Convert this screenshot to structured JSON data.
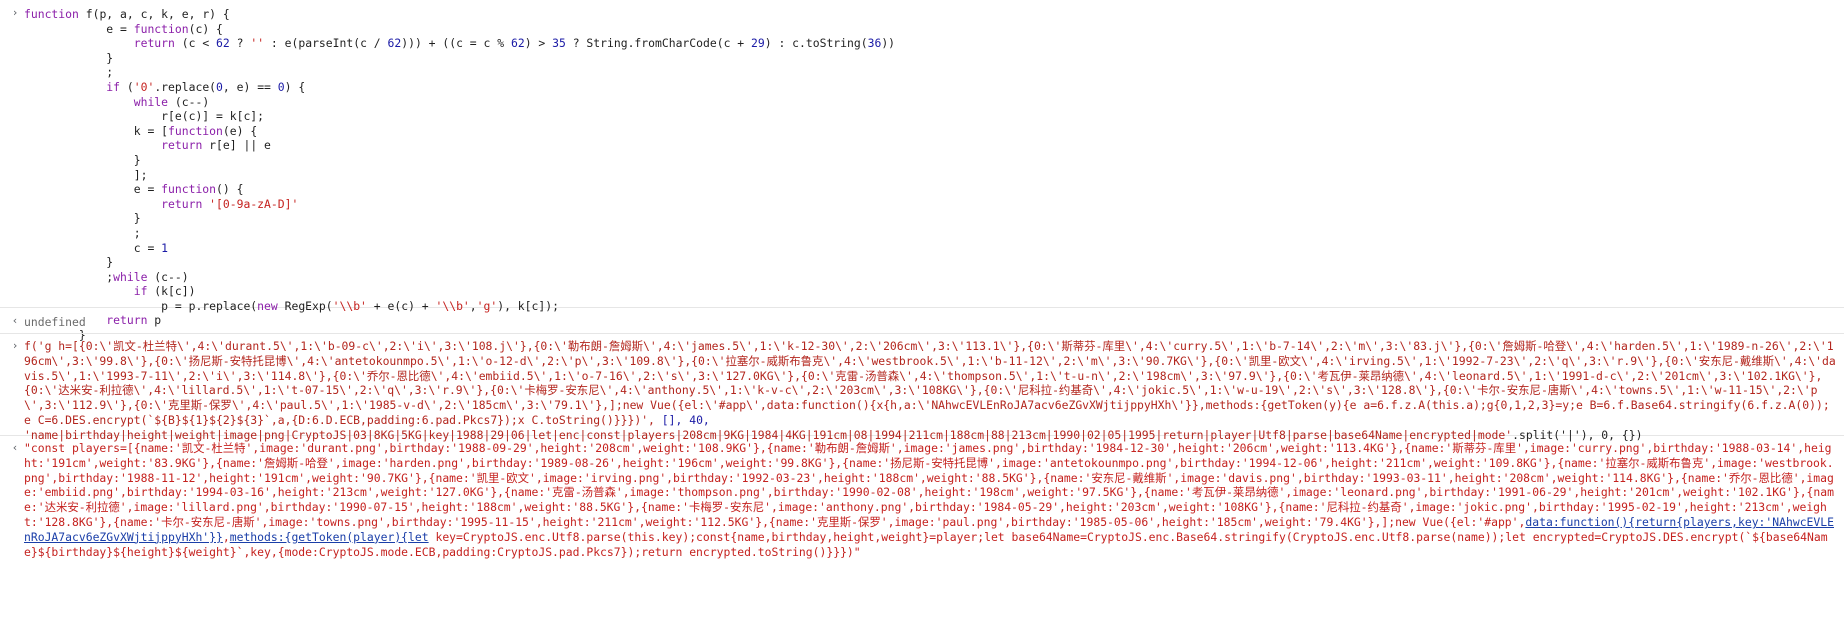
{
  "console": {
    "entry1": {
      "prompt_icon": "chevron-right-icon",
      "lines": [
        "function f(p, a, c, k, e, r) {",
        "            e = function(c) {",
        "                return (c < 62 ? '' : e(parseInt(c / 62))) + ((c = c % 62) > 35 ? String.fromCharCode(c + 29) : c.toString(36))",
        "            }",
        "            ;",
        "            if ('0'.replace(0, e) == 0) {",
        "                while (c--)",
        "                    r[e(c)] = k[c];",
        "                k = [function(e) {",
        "                    return r[e] || e",
        "                }",
        "                ];",
        "                e = function() {",
        "                    return '[0-9a-zA-D]'",
        "                }",
        "                ;",
        "                c = 1",
        "            }",
        "            ;while (c--)",
        "                if (k[c])",
        "                    p = p.replace(new RegExp('\\\\b' + e(c) + '\\\\b','g'), k[c]);",
        "            return p",
        "        }"
      ]
    },
    "entry2": {
      "result_icon": "chevron-left-icon",
      "value": "undefined"
    },
    "entry3": {
      "prompt_icon": "chevron-right-icon",
      "code": "f('g h=[{0:\\'凯文-杜兰特\\',4:\\'durant.5\\',1:\\'b-09-c\\',2:\\'i\\',3:\\'108.j\\'},{0:\\'勒布朗-詹姆斯\\',4:\\'james.5\\',1:\\'k-12-30\\',2:\\'206cm\\',3:\\'113.1\\'},{0:\\'斯蒂芬-库里\\',4:\\'curry.5\\',1:\\'b-7-14\\',2:\\'m\\',3:\\'83.j\\'},{0:\\'詹姆斯-哈登\\',4:\\'harden.5\\',1:\\'1989-n-26\\',2:\\'196cm\\',3:\\'99.8\\'},{0:\\'扬尼斯-安特托昆博\\',4:\\'antetokounmpo.5\\',1:\\'o-12-d\\',2:\\'p\\',3:\\'109.8\\'},{0:\\'拉塞尔-威斯布鲁克\\',4:\\'westbrook.5\\',1:\\'b-11-12\\',2:\\'m\\',3:\\'90.7KG\\'},{0:\\'凯里-欧文\\',4:\\'irving.5\\',1:\\'1992-7-23\\',2:\\'q\\',3:\\'r.9\\'},{0:\\'安东尼-戴维斯\\',4:\\'davis.5\\',1:\\'1993-7-11\\',2:\\'i\\',3:\\'114.8\\'},{0:\\'乔尔-恩比德\\',4:\\'embiid.5\\',1:\\'o-7-16\\',2:\\'s\\',3:\\'127.0KG\\'},{0:\\'克雷-汤普森\\',4:\\'thompson.5\\',1:\\'t-u-n\\',2:\\'198cm\\',3:\\'97.9\\'},{0:\\'考瓦伊-莱昂纳德\\',4:\\'leonard.5\\',1:\\'1991-d-c\\',2:\\'201cm\\',3:\\'102.1KG\\'},{0:\\'达米安-利拉德\\',4:\\'lillard.5\\',1:\\'t-07-15\\',2:\\'q\\',3:\\'r.9\\'},{0:\\'卡梅罗-安东尼\\',4:\\'anthony.5\\',1:\\'k-v-c\\',2:\\'203cm\\',3:\\'108KG\\'},{0:\\'尼科拉-约基奇\\',4:\\'jokic.5\\',1:\\'w-u-19\\',2:\\'s\\',3:\\'128.8\\'},{0:\\'卡尔-安东尼-唐斯\\',4:\\'towns.5\\',1:\\'w-11-15\\',2:\\'p\\',3:\\'112.9\\'},{0:\\'克里斯-保罗\\',4:\\'paul.5\\',1:\\'1985-v-d\\',2:\\'185cm\\',3:\\'79.1\\'},];new Vue({el:\\'#app\\',data:function(){x{h,a:\\'NAhwcEVLEnRoJA7acv6eZGvXWjtijppyHXh\\'}},methods:{getToken(y){e a=6.f.z.A(this.a);g{0,1,2,3}=y;e B=6.f.Base64.stringify(6.f.z.A(0));e C=6.DES.encrypt(`${B}${1}${2}${3}`,a,{D:6.D.ECB,padding:6.pad.Pkcs7});x C.toString()}}})',",
      "args_tail": " [], 40,",
      "split_string": "'name|birthday|height|weight|image|png|CryptoJS|03|8KG|5KG|key|1988|29|06|let|enc|const|players|208cm|9KG|1984|4KG|191cm|08|1994|211cm|188cm|88|213cm|1990|02|05|1995|return|player|Utf8|parse|base64Name|encrypted|mode'",
      "split_tail": ".split('|'), 0, {})"
    },
    "entry4": {
      "result_icon": "chevron-left-icon",
      "text_before_links": "\"const players=[{name:'凯文-杜兰特',image:'durant.png',birthday:'1988-09-29',height:'208cm',weight:'108.9KG'},{name:'勒布朗-詹姆斯',image:'james.png',birthday:'1984-12-30',height:'206cm',weight:'113.4KG'},{name:'斯蒂芬-库里',image:'curry.png',birthday:'1988-03-14',height:'191cm',weight:'83.9KG'},{name:'詹姆斯-哈登',image:'harden.png',birthday:'1989-08-26',height:'196cm',weight:'99.8KG'},{name:'扬尼斯-安特托昆博',image:'antetokounmpo.png',birthday:'1994-12-06',height:'211cm',weight:'109.8KG'},{name:'拉塞尔-威斯布鲁克',image:'westbrook.png',birthday:'1988-11-12',height:'191cm',weight:'90.7KG'},{name:'凯里-欧文',image:'irving.png',birthday:'1992-03-23',height:'188cm',weight:'88.5KG'},{name:'安东尼-戴维斯',image:'davis.png',birthday:'1993-03-11',height:'208cm',weight:'114.8KG'},{name:'乔尔-恩比德',image:'embiid.png',birthday:'1994-03-16',height:'213cm',weight:'127.0KG'},{name:'克雷-汤普森',image:'thompson.png',birthday:'1990-02-08',height:'198cm',weight:'97.5KG'},{name:'考瓦伊-莱昂纳德',image:'leonard.png',birthday:'1991-06-29',height:'201cm',weight:'102.1KG'},{name:'达米安-利拉德',image:'lillard.png',birthday:'1990-07-15',height:'188cm',weight:'88.5KG'},{name:'卡梅罗-安东尼',image:'anthony.png',birthday:'1984-05-29',height:'203cm',weight:'108KG'},{name:'尼科拉-约基奇',image:'jokic.png',birthday:'1995-02-19',height:'213cm',weight:'128.8KG'},{name:'卡尔-安东尼-唐斯',image:'towns.png',birthday:'1995-11-15',height:'211cm',weight:'112.5KG'},{name:'克里斯-保罗',image:'paul.png',birthday:'1985-05-06',height:'185cm',weight:'79.4KG'},];new Vue({el:'#app',",
      "link1": "data:function(){return{players,key:'NAhwcEVLEnRoJA7acv6eZGvXWjtijppyHXh'}}",
      "comma": ",",
      "link2": "methods:{getToken(player){let",
      "text_after_links": " key=CryptoJS.enc.Utf8.parse(this.key);const{name,birthday,height,weight}=player;let base64Name=CryptoJS.enc.Base64.stringify(CryptoJS.enc.Utf8.parse(name));let encrypted=CryptoJS.DES.encrypt(`${base64Name}${birthday}${height}${weight}`,key,{mode:CryptoJS.mode.ECB,padding:CryptoJS.pad.Pkcs7});return encrypted.toString()}}})\""
    }
  }
}
